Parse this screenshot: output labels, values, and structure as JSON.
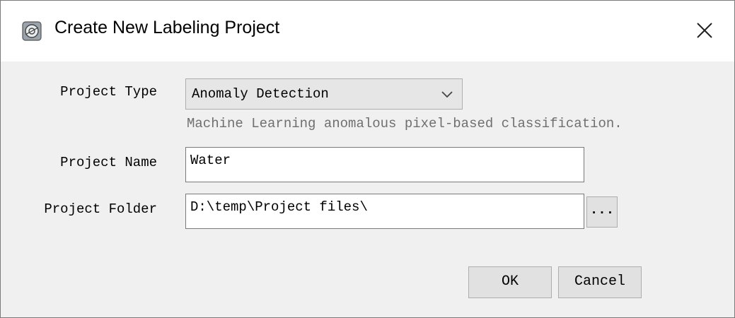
{
  "window": {
    "title": "Create New Labeling Project",
    "icon": "app-icon",
    "close_icon": "close-icon"
  },
  "form": {
    "project_type": {
      "label": "Project Type",
      "selected": "Anomaly Detection",
      "description": "Machine Learning anomalous pixel-based classification."
    },
    "project_name": {
      "label": "Project Name",
      "value": "Water"
    },
    "project_folder": {
      "label": "Project Folder",
      "value": "D:\\temp\\Project files\\",
      "browse_label": "..."
    }
  },
  "buttons": {
    "ok": "OK",
    "cancel": "Cancel"
  }
}
